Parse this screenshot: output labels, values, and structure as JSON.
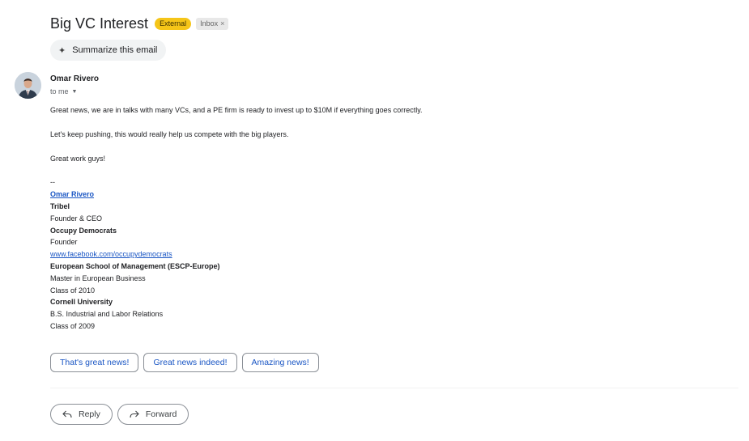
{
  "email": {
    "subject": "Big VC Interest",
    "labels": {
      "external": "External",
      "inbox": "Inbox",
      "inbox_remove": "×"
    },
    "summarize": {
      "icon": "sparkle-icon",
      "label": "Summarize this email"
    },
    "sender": {
      "name": "Omar Rivero",
      "recipient_line": "to me"
    },
    "body": [
      "Great news, we are in talks with many VCs, and a PE firm is ready to invest up to $10M if everything goes correctly.",
      "Let's keep pushing, this would really help us compete with the big players.",
      "Great work guys!"
    ],
    "signature": {
      "separator": "--",
      "name": "Omar Rivero",
      "company1": "Tribel",
      "title1": "Founder & CEO",
      "company2": "Occupy Democrats",
      "title2": "Founder",
      "link": "www.facebook.com/occupydemocrats",
      "school1": "European School of Management (ESCP-Europe)",
      "degree1": "Master in European Business",
      "class1": "Class of 2010",
      "school2": "Cornell University",
      "degree2": "B.S. Industrial and Labor Relations",
      "class2": "Class of 2009"
    },
    "smart_replies": [
      "That's great news!",
      "Great news indeed!",
      "Amazing news!"
    ],
    "actions": {
      "reply": "Reply",
      "forward": "Forward"
    }
  },
  "colors": {
    "external_badge": "#f5c518",
    "link": "#1a56c4"
  }
}
